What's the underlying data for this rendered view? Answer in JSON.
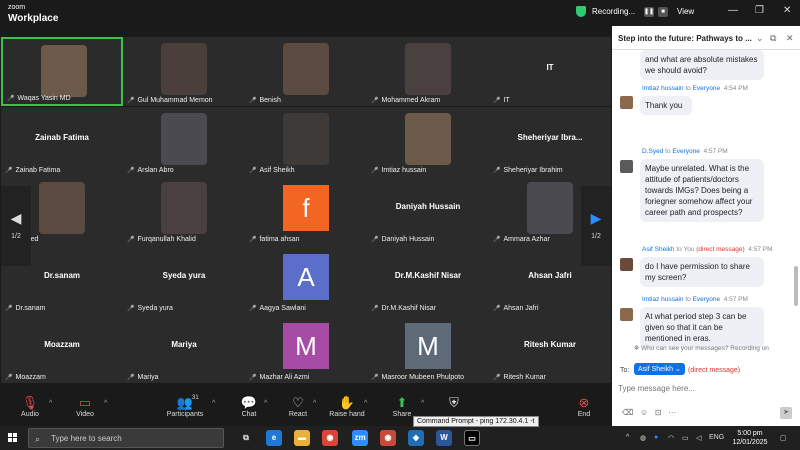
{
  "app": {
    "brand_line1": "zoom",
    "brand_line2": "Workplace",
    "recording_label": "Recording...",
    "view_label": "View"
  },
  "grid": {
    "tiles": [
      {
        "name": "Waqas Yasin MD",
        "big": "",
        "type": "photo",
        "muted": false
      },
      {
        "name": "Gul Muhammad Memon",
        "big": "",
        "type": "photo",
        "muted": false
      },
      {
        "name": "Benish",
        "big": "",
        "type": "photo",
        "muted": false
      },
      {
        "name": "Mohammed Akram",
        "big": "",
        "type": "photo",
        "muted": false
      },
      {
        "name": "IT",
        "big": "IT",
        "type": "name",
        "muted": true
      },
      {
        "name": "Zainab Fatima",
        "big": "Zainab Fatima",
        "type": "name",
        "muted": true
      },
      {
        "name": "Arslan Abro",
        "big": "",
        "type": "photo",
        "muted": true
      },
      {
        "name": "Asif Sheikh",
        "big": "",
        "type": "photo",
        "muted": true
      },
      {
        "name": "Imtiaz hussain",
        "big": "",
        "type": "photo",
        "muted": true
      },
      {
        "name": "Sheheriyar Ibrahim",
        "big": "Sheheriyar  Ibra...",
        "type": "name",
        "muted": true
      },
      {
        "name": "D.Syed",
        "big": "",
        "type": "photo",
        "muted": false
      },
      {
        "name": "Furqanullah Khalid",
        "big": "",
        "type": "photo",
        "muted": true
      },
      {
        "name": "fatima ahsan",
        "big": "",
        "type": "avatar",
        "letter": "f",
        "color": "#f26522",
        "muted": true
      },
      {
        "name": "Daniyah Hussain",
        "big": "Daniyah Hussain",
        "type": "name",
        "muted": true
      },
      {
        "name": "Ammara Azhar",
        "big": "",
        "type": "photo",
        "muted": true
      },
      {
        "name": "Dr.sanam",
        "big": "Dr.sanam",
        "type": "name",
        "muted": true
      },
      {
        "name": "Syeda yura",
        "big": "Syeda yura",
        "type": "name",
        "muted": true
      },
      {
        "name": "Aagya Sawlani",
        "big": "",
        "type": "avatar",
        "letter": "A",
        "color": "#5b6ec9",
        "muted": true
      },
      {
        "name": "Dr.M.Kashif Nisar",
        "big": "Dr.M.Kashif Nisar",
        "type": "name",
        "muted": true
      },
      {
        "name": "Ahsan Jafri",
        "big": "Ahsan Jafri",
        "type": "name",
        "muted": true
      },
      {
        "name": "Moazzam",
        "big": "Moazzam",
        "type": "name",
        "muted": true
      },
      {
        "name": "Mariya",
        "big": "Mariya",
        "type": "name",
        "muted": true
      },
      {
        "name": "Mazhar Ali Azmi",
        "big": "",
        "type": "avatar",
        "letter": "M",
        "color": "#a64ca6",
        "muted": true
      },
      {
        "name": "Masroor Mubeen Phulpoto",
        "big": "",
        "type": "avatar",
        "letter": "M",
        "color": "#5e6a78",
        "muted": true
      },
      {
        "name": "Ritesh Kumar",
        "big": "Ritesh Kumar",
        "type": "name",
        "muted": true
      }
    ],
    "page_left": "1/2",
    "page_right": "1/2"
  },
  "toolbar": {
    "audio": "Audio",
    "video": "Video",
    "participants": "Participants",
    "participants_count": "31",
    "chat": "Chat",
    "react": "React",
    "raise_hand": "Raise hand",
    "share": "Share",
    "end": "End",
    "tooltip": "Command Prompt - ping  172.30.4.1 -t"
  },
  "chat": {
    "title": "Step into the future: Pathways to ...",
    "partial_text": "and what are absolute mistakes we should avoid?",
    "messages": [
      {
        "from": "Imtiaz hussain",
        "to": "Everyone",
        "time": "4:54 PM",
        "dm": "",
        "text": "Thank you"
      },
      {
        "from": "D.Syed",
        "to": "Everyone",
        "time": "4:57 PM",
        "dm": "",
        "text": "Maybe unrelated. What is the attitude of patients/doctors towards IMGs? Does being a foriegner somehow affect your career path and prospects?"
      },
      {
        "from": "Asif Sheikh",
        "to": "You",
        "time": "4:57 PM",
        "dm": "(direct message)",
        "text": "do I have permission to share my screen?"
      },
      {
        "from": "Imtiaz hussain",
        "to": "Everyone",
        "time": "4:57 PM",
        "dm": "",
        "text": "At what period  step 3 can be given  so that it can be mentioned in eras."
      }
    ],
    "word_to": "to",
    "who_can_see": "Who can see your messages? Recording on",
    "to_label": "To:",
    "to_value": "Asif Sheikh",
    "to_dm": "(direct message)",
    "input_placeholder": "Type message here..."
  },
  "taskbar": {
    "search_placeholder": "Type here to search",
    "lang": "ENG",
    "time": "5:00 pm",
    "date": "12/01/2025"
  }
}
